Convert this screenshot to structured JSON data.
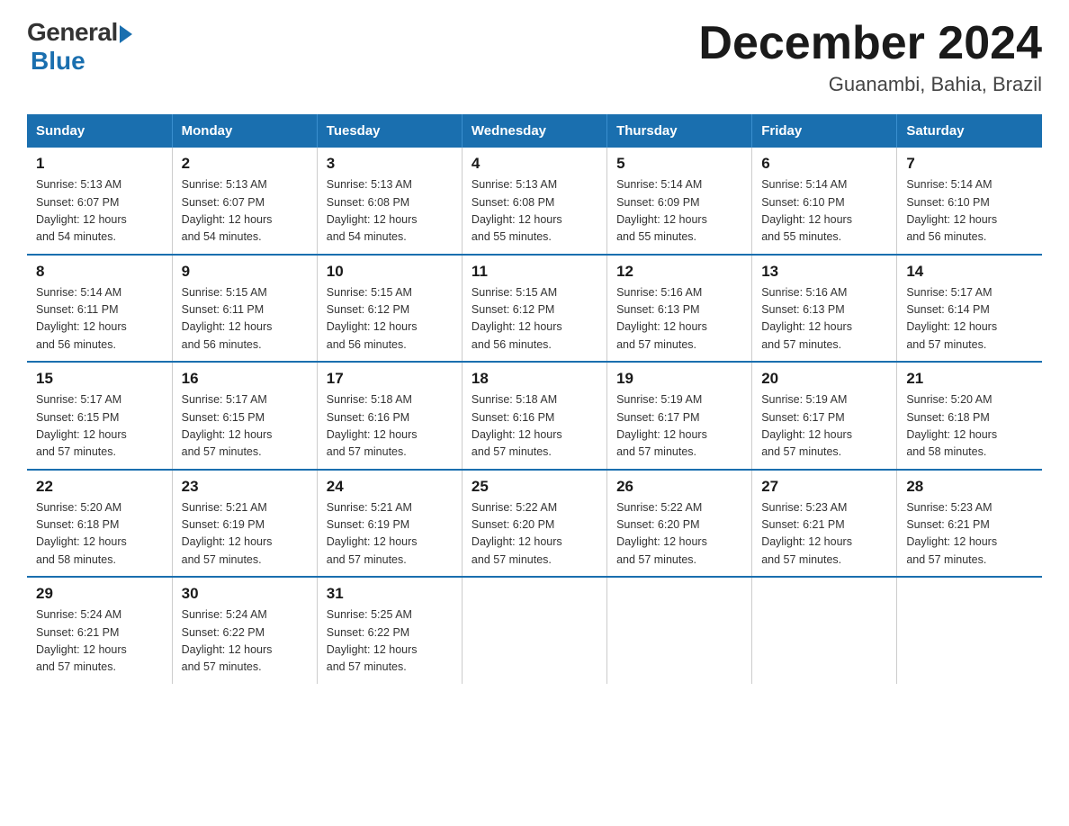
{
  "logo": {
    "general": "General",
    "blue": "Blue"
  },
  "title": "December 2024",
  "subtitle": "Guanambi, Bahia, Brazil",
  "days_of_week": [
    "Sunday",
    "Monday",
    "Tuesday",
    "Wednesday",
    "Thursday",
    "Friday",
    "Saturday"
  ],
  "weeks": [
    [
      {
        "day": "1",
        "info": "Sunrise: 5:13 AM\nSunset: 6:07 PM\nDaylight: 12 hours\nand 54 minutes."
      },
      {
        "day": "2",
        "info": "Sunrise: 5:13 AM\nSunset: 6:07 PM\nDaylight: 12 hours\nand 54 minutes."
      },
      {
        "day": "3",
        "info": "Sunrise: 5:13 AM\nSunset: 6:08 PM\nDaylight: 12 hours\nand 54 minutes."
      },
      {
        "day": "4",
        "info": "Sunrise: 5:13 AM\nSunset: 6:08 PM\nDaylight: 12 hours\nand 55 minutes."
      },
      {
        "day": "5",
        "info": "Sunrise: 5:14 AM\nSunset: 6:09 PM\nDaylight: 12 hours\nand 55 minutes."
      },
      {
        "day": "6",
        "info": "Sunrise: 5:14 AM\nSunset: 6:10 PM\nDaylight: 12 hours\nand 55 minutes."
      },
      {
        "day": "7",
        "info": "Sunrise: 5:14 AM\nSunset: 6:10 PM\nDaylight: 12 hours\nand 56 minutes."
      }
    ],
    [
      {
        "day": "8",
        "info": "Sunrise: 5:14 AM\nSunset: 6:11 PM\nDaylight: 12 hours\nand 56 minutes."
      },
      {
        "day": "9",
        "info": "Sunrise: 5:15 AM\nSunset: 6:11 PM\nDaylight: 12 hours\nand 56 minutes."
      },
      {
        "day": "10",
        "info": "Sunrise: 5:15 AM\nSunset: 6:12 PM\nDaylight: 12 hours\nand 56 minutes."
      },
      {
        "day": "11",
        "info": "Sunrise: 5:15 AM\nSunset: 6:12 PM\nDaylight: 12 hours\nand 56 minutes."
      },
      {
        "day": "12",
        "info": "Sunrise: 5:16 AM\nSunset: 6:13 PM\nDaylight: 12 hours\nand 57 minutes."
      },
      {
        "day": "13",
        "info": "Sunrise: 5:16 AM\nSunset: 6:13 PM\nDaylight: 12 hours\nand 57 minutes."
      },
      {
        "day": "14",
        "info": "Sunrise: 5:17 AM\nSunset: 6:14 PM\nDaylight: 12 hours\nand 57 minutes."
      }
    ],
    [
      {
        "day": "15",
        "info": "Sunrise: 5:17 AM\nSunset: 6:15 PM\nDaylight: 12 hours\nand 57 minutes."
      },
      {
        "day": "16",
        "info": "Sunrise: 5:17 AM\nSunset: 6:15 PM\nDaylight: 12 hours\nand 57 minutes."
      },
      {
        "day": "17",
        "info": "Sunrise: 5:18 AM\nSunset: 6:16 PM\nDaylight: 12 hours\nand 57 minutes."
      },
      {
        "day": "18",
        "info": "Sunrise: 5:18 AM\nSunset: 6:16 PM\nDaylight: 12 hours\nand 57 minutes."
      },
      {
        "day": "19",
        "info": "Sunrise: 5:19 AM\nSunset: 6:17 PM\nDaylight: 12 hours\nand 57 minutes."
      },
      {
        "day": "20",
        "info": "Sunrise: 5:19 AM\nSunset: 6:17 PM\nDaylight: 12 hours\nand 57 minutes."
      },
      {
        "day": "21",
        "info": "Sunrise: 5:20 AM\nSunset: 6:18 PM\nDaylight: 12 hours\nand 58 minutes."
      }
    ],
    [
      {
        "day": "22",
        "info": "Sunrise: 5:20 AM\nSunset: 6:18 PM\nDaylight: 12 hours\nand 58 minutes."
      },
      {
        "day": "23",
        "info": "Sunrise: 5:21 AM\nSunset: 6:19 PM\nDaylight: 12 hours\nand 57 minutes."
      },
      {
        "day": "24",
        "info": "Sunrise: 5:21 AM\nSunset: 6:19 PM\nDaylight: 12 hours\nand 57 minutes."
      },
      {
        "day": "25",
        "info": "Sunrise: 5:22 AM\nSunset: 6:20 PM\nDaylight: 12 hours\nand 57 minutes."
      },
      {
        "day": "26",
        "info": "Sunrise: 5:22 AM\nSunset: 6:20 PM\nDaylight: 12 hours\nand 57 minutes."
      },
      {
        "day": "27",
        "info": "Sunrise: 5:23 AM\nSunset: 6:21 PM\nDaylight: 12 hours\nand 57 minutes."
      },
      {
        "day": "28",
        "info": "Sunrise: 5:23 AM\nSunset: 6:21 PM\nDaylight: 12 hours\nand 57 minutes."
      }
    ],
    [
      {
        "day": "29",
        "info": "Sunrise: 5:24 AM\nSunset: 6:21 PM\nDaylight: 12 hours\nand 57 minutes."
      },
      {
        "day": "30",
        "info": "Sunrise: 5:24 AM\nSunset: 6:22 PM\nDaylight: 12 hours\nand 57 minutes."
      },
      {
        "day": "31",
        "info": "Sunrise: 5:25 AM\nSunset: 6:22 PM\nDaylight: 12 hours\nand 57 minutes."
      },
      {
        "day": "",
        "info": ""
      },
      {
        "day": "",
        "info": ""
      },
      {
        "day": "",
        "info": ""
      },
      {
        "day": "",
        "info": ""
      }
    ]
  ]
}
